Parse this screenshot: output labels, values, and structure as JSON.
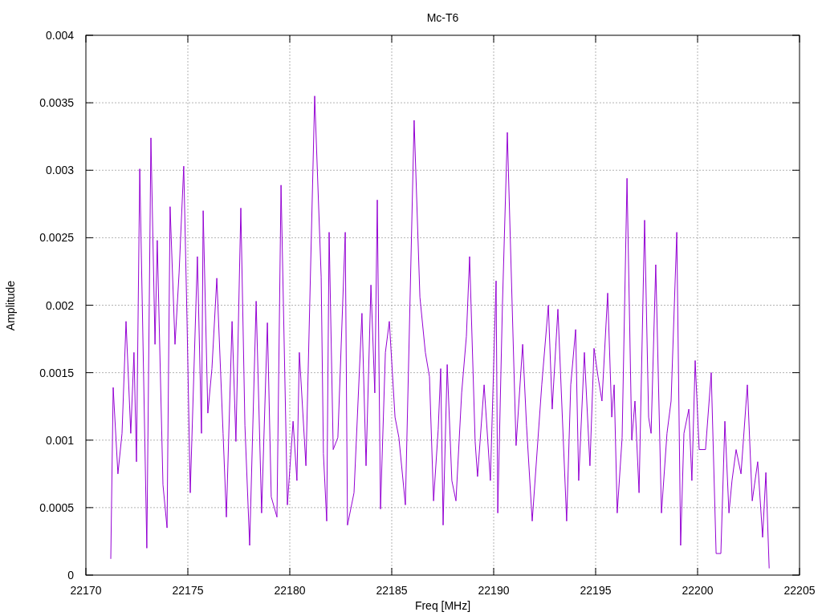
{
  "chart_data": {
    "type": "line",
    "title": "Mc-T6",
    "xlabel": "Freq [MHz]",
    "ylabel": "Amplitude",
    "grid": true,
    "xlim": [
      22170,
      22205
    ],
    "ylim": [
      0,
      0.004
    ],
    "xticks": [
      22170,
      22175,
      22180,
      22185,
      22190,
      22195,
      22200,
      22205
    ],
    "yticks": [
      0,
      0.0005,
      0.001,
      0.0015,
      0.002,
      0.0025,
      0.003,
      0.0035,
      0.004
    ],
    "x": [
      22171.22,
      22171.34,
      22171.57,
      22171.77,
      22171.97,
      22172.2,
      22172.36,
      22172.48,
      22172.64,
      22172.99,
      22173.19,
      22173.39,
      22173.5,
      22173.78,
      22173.98,
      22174.13,
      22174.37,
      22174.57,
      22174.8,
      22174.96,
      22175.12,
      22175.47,
      22175.67,
      22175.75,
      22175.98,
      22176.18,
      22176.42,
      22176.73,
      22176.89,
      22177.17,
      22177.36,
      22177.6,
      22177.8,
      22178.03,
      22178.35,
      22178.62,
      22178.9,
      22179.09,
      22179.37,
      22179.57,
      22179.88,
      22180.16,
      22180.35,
      22180.47,
      22180.79,
      22181.22,
      22181.54,
      22181.65,
      22181.81,
      22181.93,
      22182.13,
      22182.36,
      22182.72,
      22182.83,
      22183.15,
      22183.54,
      22183.74,
      22183.98,
      22184.17,
      22184.29,
      22184.45,
      22184.69,
      22184.88,
      22185.16,
      22185.35,
      22185.67,
      22186.1,
      22186.38,
      22186.65,
      22186.85,
      22187.05,
      22187.28,
      22187.4,
      22187.52,
      22187.72,
      22187.95,
      22188.15,
      22188.43,
      22188.66,
      22188.82,
      22189.09,
      22189.21,
      22189.53,
      22189.84,
      22190.12,
      22190.2,
      22190.43,
      22190.67,
      22191.1,
      22191.42,
      22191.61,
      22191.89,
      22192.36,
      22192.68,
      22192.87,
      22193.15,
      22193.58,
      22193.78,
      22194.02,
      22194.17,
      22194.45,
      22194.72,
      22194.92,
      22195.12,
      22195.31,
      22195.59,
      22195.79,
      22195.91,
      22196.06,
      22196.3,
      22196.54,
      22196.77,
      22196.93,
      22197.13,
      22197.4,
      22197.6,
      22197.72,
      22197.95,
      22198.23,
      22198.5,
      22198.7,
      22198.98,
      22199.17,
      22199.33,
      22199.57,
      22199.72,
      22199.88,
      22200.08,
      22200.39,
      22200.67,
      22200.91,
      22201.14,
      22201.34,
      22201.54,
      22201.69,
      22201.89,
      22202.13,
      22202.44,
      22202.68,
      22202.95,
      22203.19,
      22203.35,
      22203.51
    ],
    "series": [
      {
        "color": "#9400d3",
        "values": [
          0.00012,
          0.00139,
          0.00075,
          0.00105,
          0.00188,
          0.00105,
          0.00165,
          0.00084,
          0.00301,
          0.0002,
          0.00324,
          0.00171,
          0.00248,
          0.00067,
          0.00035,
          0.00273,
          0.00171,
          0.00224,
          0.00303,
          0.00188,
          0.00061,
          0.00236,
          0.00105,
          0.0027,
          0.0012,
          0.00153,
          0.0022,
          0.00105,
          0.00043,
          0.00188,
          0.00099,
          0.00272,
          0.00111,
          0.00022,
          0.00203,
          0.00046,
          0.00187,
          0.00058,
          0.00043,
          0.00289,
          0.00052,
          0.00114,
          0.0007,
          0.00165,
          0.00081,
          0.00355,
          0.00221,
          0.0009,
          0.0004,
          0.00254,
          0.00093,
          0.00102,
          0.00254,
          0.00037,
          0.00061,
          0.00194,
          0.00081,
          0.00215,
          0.00135,
          0.00278,
          0.00049,
          0.00165,
          0.00188,
          0.00117,
          0.00102,
          0.00052,
          0.00337,
          0.00206,
          0.00165,
          0.00147,
          0.00055,
          0.00108,
          0.00153,
          0.00037,
          0.00156,
          0.0007,
          0.00055,
          0.00135,
          0.00177,
          0.00236,
          0.00099,
          0.00073,
          0.00141,
          0.0007,
          0.00218,
          0.00046,
          0.002,
          0.00328,
          0.00096,
          0.00171,
          0.00111,
          0.0004,
          0.00141,
          0.002,
          0.00123,
          0.00197,
          0.0004,
          0.00141,
          0.00182,
          0.0007,
          0.00165,
          0.00081,
          0.00168,
          0.00147,
          0.00129,
          0.00209,
          0.00117,
          0.00141,
          0.00046,
          0.00102,
          0.00294,
          0.001,
          0.00129,
          0.00061,
          0.00263,
          0.00117,
          0.00105,
          0.0023,
          0.00046,
          0.00105,
          0.00129,
          0.00254,
          0.00022,
          0.00105,
          0.00123,
          0.0007,
          0.00159,
          0.00093,
          0.00093,
          0.0015,
          0.00016,
          0.00016,
          0.00114,
          0.00046,
          0.0007,
          0.00093,
          0.00075,
          0.00141,
          0.00055,
          0.00084,
          0.00028,
          0.00076,
          5e-05
        ]
      }
    ]
  }
}
